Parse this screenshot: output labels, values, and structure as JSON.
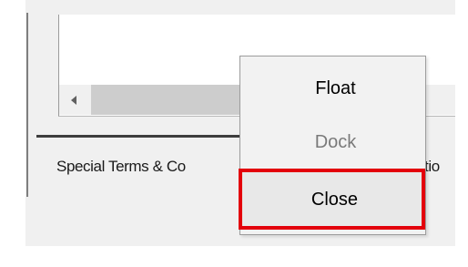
{
  "scroll": {
    "left_arrow_icon": "triangle-left-icon"
  },
  "section": {
    "label": "Special Terms & Co",
    "label_tail": "tio"
  },
  "context_menu": {
    "items": [
      {
        "label": "Float",
        "enabled": true
      },
      {
        "label": "Dock",
        "enabled": false
      },
      {
        "label": "Close",
        "enabled": true,
        "highlighted": true
      }
    ]
  },
  "colors": {
    "highlight_border": "#e3000b",
    "disabled_text": "#7a7a7a",
    "menu_background": "#f2f2f2"
  }
}
